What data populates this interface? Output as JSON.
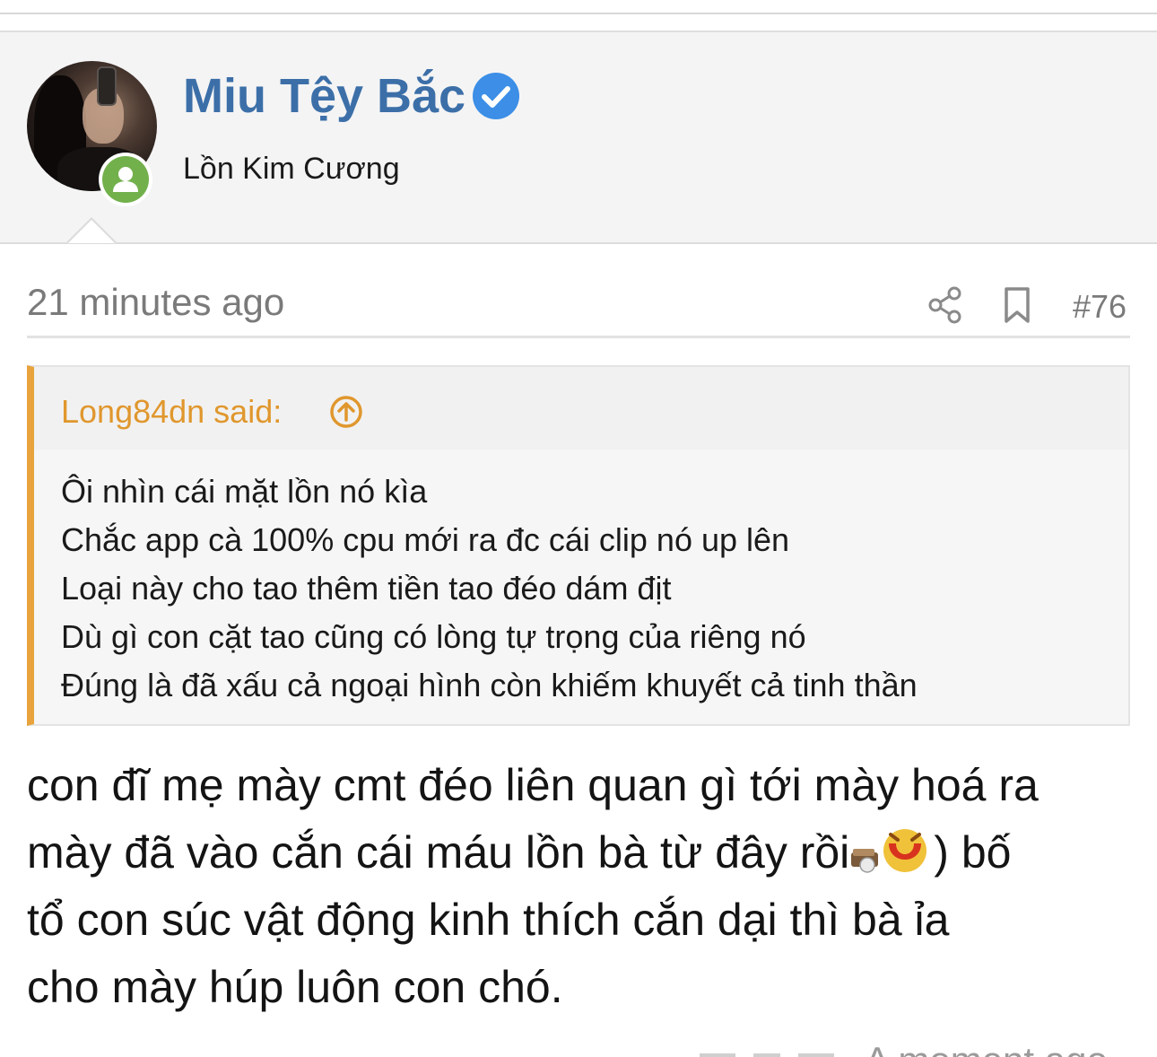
{
  "header": {
    "username": "Miu Tệy Bắc",
    "user_title": "Lồn Kim Cương",
    "verified": true,
    "online_status": "online",
    "accent_color": "#3c6fa8",
    "status_color": "#72b04c"
  },
  "post_meta": {
    "time": "21 minutes ago",
    "share_icon": "share-icon",
    "bookmark_icon": "bookmark-icon",
    "post_number": "#76"
  },
  "quote": {
    "author_line": "Long84dn said:",
    "jump_icon": "arrow-up-circle-icon",
    "accent_color": "#e8a33c",
    "lines": [
      "Ôi nhìn cái mặt lồn nó kìa",
      "Chắc app cà 100% cpu mới ra đc cái clip nó up lên",
      "Loại này cho tao thêm tiền tao đéo dám địt",
      "Dù gì con cặt tao cũng có lòng tự trọng của riêng nó",
      "Đúng là đã xấu cả ngoại hình còn khiếm khuyết cả tinh thần"
    ]
  },
  "message": {
    "line1": "con đĩ mẹ mày cmt đéo liên quan gì tới mày hoá ra",
    "line2_before": "mày đã vào cắn cái máu lồn bà từ đây rồi",
    "line2_after": ") bố",
    "line3": "tổ con súc vật động kinh thích cắn dại thì bà ỉa",
    "line4": "cho mày húp luôn con chó."
  },
  "next_post_peek": {
    "time": "A moment ago"
  }
}
